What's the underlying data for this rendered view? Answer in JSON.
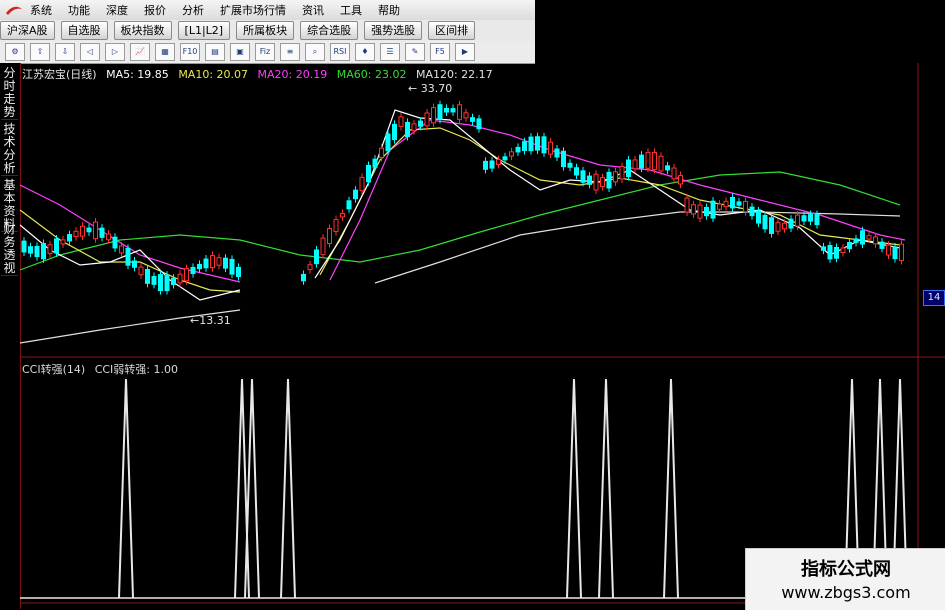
{
  "menu": {
    "items": [
      "系统",
      "功能",
      "深度",
      "报价",
      "分析",
      "扩展市场行情",
      "资讯",
      "工具",
      "帮助"
    ]
  },
  "tabs": [
    "沪深A股",
    "自选股",
    "板块指数",
    "[L1|L2]",
    "所属板块",
    "综合选股",
    "强势选股",
    "区间排"
  ],
  "toolbar": {
    "icons": [
      "gear-icon",
      "arrow-up-icon",
      "arrow-down-icon",
      "arrow-left-icon",
      "arrow-right-icon",
      "chart-icon",
      "grid-icon",
      "f10-icon",
      "period-icon",
      "figure-icon",
      "fiz-icon",
      "level-icon",
      "search-icon",
      "rsi-icon",
      "stock-icon",
      "layers-icon",
      "pencil-icon",
      "f5-icon",
      "right-icon"
    ],
    "labels": {
      "f10": "F10",
      "fiz": "Fiz",
      "rsi": "RSI",
      "f5": "F5"
    }
  },
  "sidebar": {
    "tabs": [
      "分时走势",
      "技术分析",
      "基本资料",
      "财务透视"
    ]
  },
  "stock": {
    "title": "江苏宏宝(日线)",
    "ma5": "MA5: 19.85",
    "ma10": "MA10: 20.07",
    "ma20": "MA20: 20.19",
    "ma60": "MA60: 23.02",
    "ma120": "MA120: 22.17",
    "high_label": "33.70",
    "low_label": "13.31",
    "right_label": "14"
  },
  "indicator": {
    "name": "CCI转强(14)",
    "param": "CCI弱转强: 1.00"
  },
  "colors": {
    "ma5": "#ffffff",
    "ma10": "#e8e850",
    "ma20": "#ff40ff",
    "ma60": "#33dd33",
    "ma120": "#e0e0e0",
    "up": "#ff3030",
    "down": "#00ffff",
    "grid": "#8a1414"
  },
  "watermark": {
    "title": "指标公式网",
    "url": "www.zbgs3.com"
  }
}
